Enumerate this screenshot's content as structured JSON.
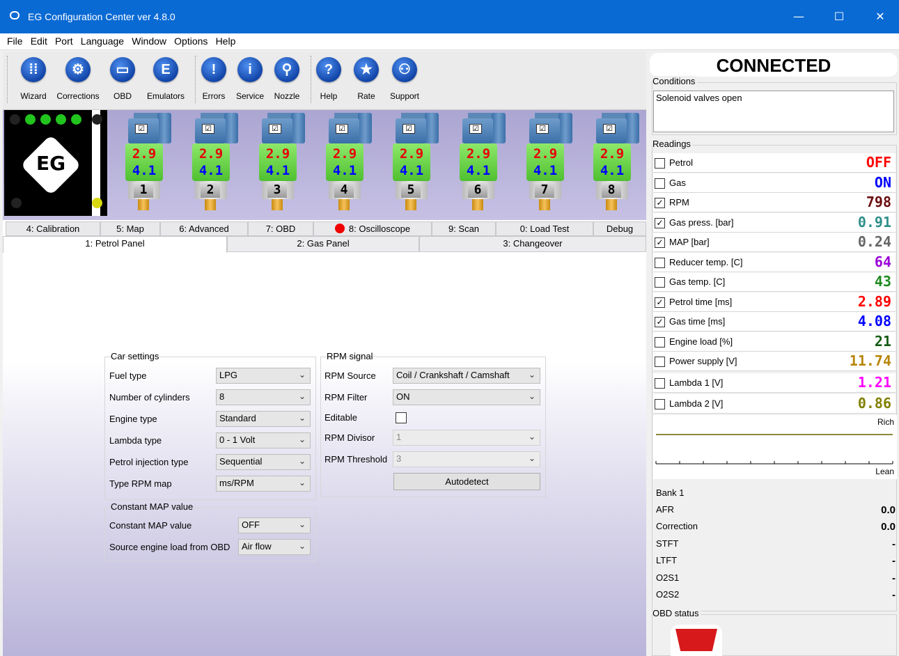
{
  "window": {
    "title": "EG Configuration Center ver 4.8.0",
    "min": "—",
    "max": "☐",
    "close": "✕"
  },
  "menu": [
    "File",
    "Edit",
    "Port",
    "Language",
    "Window",
    "Options",
    "Help"
  ],
  "toolbar": {
    "buttons": [
      {
        "label": "Wizard",
        "glyph": "⁞⁞",
        "icon": "grid-icon"
      },
      {
        "label": "Corrections",
        "glyph": "⚙",
        "icon": "gear-icon"
      },
      {
        "label": "OBD",
        "glyph": "▭",
        "icon": "obd-connector-icon"
      },
      {
        "label": "Emulators",
        "glyph": "E",
        "icon": "emulator-icon"
      },
      {
        "label": "Errors",
        "glyph": "!",
        "icon": "error-icon"
      },
      {
        "label": "Service",
        "glyph": "i",
        "icon": "info-icon"
      },
      {
        "label": "Nozzle",
        "glyph": "⚲",
        "icon": "nozzle-icon"
      },
      {
        "label": "Help",
        "glyph": "?",
        "icon": "help-icon"
      },
      {
        "label": "Rate",
        "glyph": "★",
        "icon": "star-icon"
      },
      {
        "label": "Support",
        "glyph": "⚇",
        "icon": "support-icon"
      }
    ]
  },
  "injectors": [
    {
      "num": "1",
      "petrol": "2.9",
      "gas": "4.1"
    },
    {
      "num": "2",
      "petrol": "2.9",
      "gas": "4.1"
    },
    {
      "num": "3",
      "petrol": "2.9",
      "gas": "4.1"
    },
    {
      "num": "4",
      "petrol": "2.9",
      "gas": "4.1"
    },
    {
      "num": "5",
      "petrol": "2.9",
      "gas": "4.1"
    },
    {
      "num": "6",
      "petrol": "2.9",
      "gas": "4.1"
    },
    {
      "num": "7",
      "petrol": "2.9",
      "gas": "4.1"
    },
    {
      "num": "8",
      "petrol": "2.9",
      "gas": "4.1"
    }
  ],
  "logo_text": "EG",
  "tabs_row1": [
    "4: Calibration",
    "5: Map",
    "6: Advanced",
    "7: OBD",
    "8: Oscilloscope",
    "9: Scan",
    "0: Load Test",
    "Debug"
  ],
  "tabs_row2": [
    "1: Petrol Panel",
    "2: Gas Panel",
    "3: Changeover"
  ],
  "car_settings": {
    "title": "Car settings",
    "rows": [
      {
        "label": "Fuel type",
        "value": "LPG"
      },
      {
        "label": "Number of cylinders",
        "value": "8"
      },
      {
        "label": "Engine type",
        "value": "Standard"
      },
      {
        "label": "Lambda type",
        "value": "0 - 1 Volt"
      },
      {
        "label": "Petrol injection type",
        "value": "Sequential"
      },
      {
        "label": "Type RPM map",
        "value": "ms/RPM"
      }
    ]
  },
  "constant_map": {
    "title": "Constant MAP value",
    "rows": [
      {
        "label": "Constant MAP value",
        "value": "OFF"
      },
      {
        "label": "Source engine load from OBD",
        "value": "Air flow"
      }
    ]
  },
  "rpm_signal": {
    "title": "RPM signal",
    "source_label": "RPM Source",
    "source_value": "Coil / Crankshaft / Camshaft",
    "filter_label": "RPM Filter",
    "filter_value": "ON",
    "editable_label": "Editable",
    "divisor_label": "RPM Divisor",
    "divisor_value": "1",
    "threshold_label": "RPM Threshold",
    "threshold_value": "3",
    "autodetect": "Autodetect"
  },
  "status": {
    "connected": "CONNECTED",
    "conditions_title": "Conditions",
    "conditions_text": "Solenoid valves open",
    "readings_title": "Readings"
  },
  "readings": [
    {
      "name": "Petrol",
      "checked": false,
      "value": "OFF",
      "color": "#ff0000"
    },
    {
      "name": "Gas",
      "checked": false,
      "value": "ON",
      "color": "#0000ff"
    },
    {
      "name": "RPM",
      "checked": true,
      "value": "798",
      "color": "#6b0d0d"
    },
    {
      "name": "Gas press. [bar]",
      "checked": true,
      "value": "0.91",
      "color": "#2f8f8a"
    },
    {
      "name": "MAP [bar]",
      "checked": true,
      "value": "0.24",
      "color": "#666666"
    },
    {
      "name": "Reducer temp. [C]",
      "checked": false,
      "value": "64",
      "color": "#9a00d8"
    },
    {
      "name": "Gas temp. [C]",
      "checked": false,
      "value": "43",
      "color": "#1e8a1e"
    },
    {
      "name": "Petrol time [ms]",
      "checked": true,
      "value": "2.89",
      "color": "#ff0000"
    },
    {
      "name": "Gas time [ms]",
      "checked": true,
      "value": "4.08",
      "color": "#0000ff"
    },
    {
      "name": "Engine load [%]",
      "checked": false,
      "value": "21",
      "color": "#145c14"
    },
    {
      "name": "Power supply [V]",
      "checked": false,
      "value": "11.74",
      "color": "#b8860b"
    },
    {
      "name": "Lambda 1 [V]",
      "checked": false,
      "value": "1.21",
      "color": "#ff00ff"
    },
    {
      "name": "Lambda 2 [V]",
      "checked": false,
      "value": "0.86",
      "color": "#808000"
    }
  ],
  "lambda_graph": {
    "rich": "Rich",
    "lean": "Lean"
  },
  "bank": {
    "title": "Bank 1",
    "rows": [
      {
        "label": "AFR",
        "value": "0.0"
      },
      {
        "label": "Correction",
        "value": "0.0"
      },
      {
        "label": "STFT",
        "value": "-"
      },
      {
        "label": "LTFT",
        "value": "-"
      },
      {
        "label": "O2S1",
        "value": "-"
      },
      {
        "label": "O2S2",
        "value": "-"
      }
    ]
  },
  "obd_status": {
    "title": "OBD status"
  }
}
